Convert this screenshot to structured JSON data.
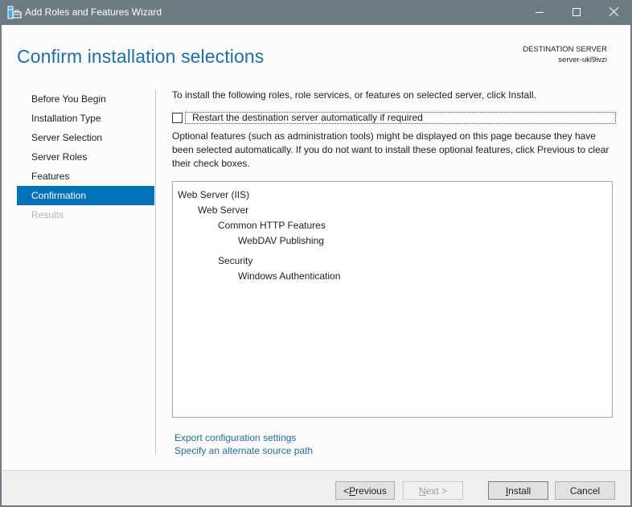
{
  "window": {
    "title": "Add Roles and Features Wizard",
    "icon": "server-manager-wizard-icon",
    "controls": {
      "minimize_icon": "minimize-icon",
      "maximize_icon": "maximize-icon",
      "close_icon": "close-icon"
    }
  },
  "header": {
    "page_title": "Confirm installation selections",
    "destination_label": "DESTINATION SERVER",
    "destination_server": "server-ukl9ivzi"
  },
  "nav": {
    "items": [
      {
        "label": "Before You Begin",
        "state": "normal"
      },
      {
        "label": "Installation Type",
        "state": "normal"
      },
      {
        "label": "Server Selection",
        "state": "normal"
      },
      {
        "label": "Server Roles",
        "state": "normal"
      },
      {
        "label": "Features",
        "state": "normal"
      },
      {
        "label": "Confirmation",
        "state": "active"
      },
      {
        "label": "Results",
        "state": "disabled"
      }
    ]
  },
  "content": {
    "intro": "To install the following roles, role services, or features on selected server, click Install.",
    "restart_checkbox": {
      "label": "Restart the destination server automatically if required",
      "checked": false
    },
    "optional_note": "Optional features (such as administration tools) might be displayed on this page because they have been selected automatically. If you do not want to install these optional features, click Previous to clear their check boxes.",
    "selections": [
      {
        "label": "Web Server (IIS)",
        "level": 0
      },
      {
        "label": "Web Server",
        "level": 1
      },
      {
        "label": "Common HTTP Features",
        "level": 2
      },
      {
        "label": "WebDAV Publishing",
        "level": 3
      },
      {
        "label": "Security",
        "level": 2
      },
      {
        "label": "Windows Authentication",
        "level": 3
      }
    ],
    "links": {
      "export": "Export configuration settings",
      "alternate_source": "Specify an alternate source path"
    }
  },
  "footer": {
    "previous": {
      "prefix": "< ",
      "accel": "P",
      "rest": "revious"
    },
    "next": {
      "accel": "N",
      "rest": "ext >",
      "enabled": false
    },
    "install": {
      "accel": "I",
      "rest": "nstall"
    },
    "cancel": "Cancel"
  },
  "colors": {
    "titlebar": "#6d7b82",
    "accent": "#0072bc",
    "title_text": "#1f6f9c",
    "link": "#1f6f9c"
  }
}
